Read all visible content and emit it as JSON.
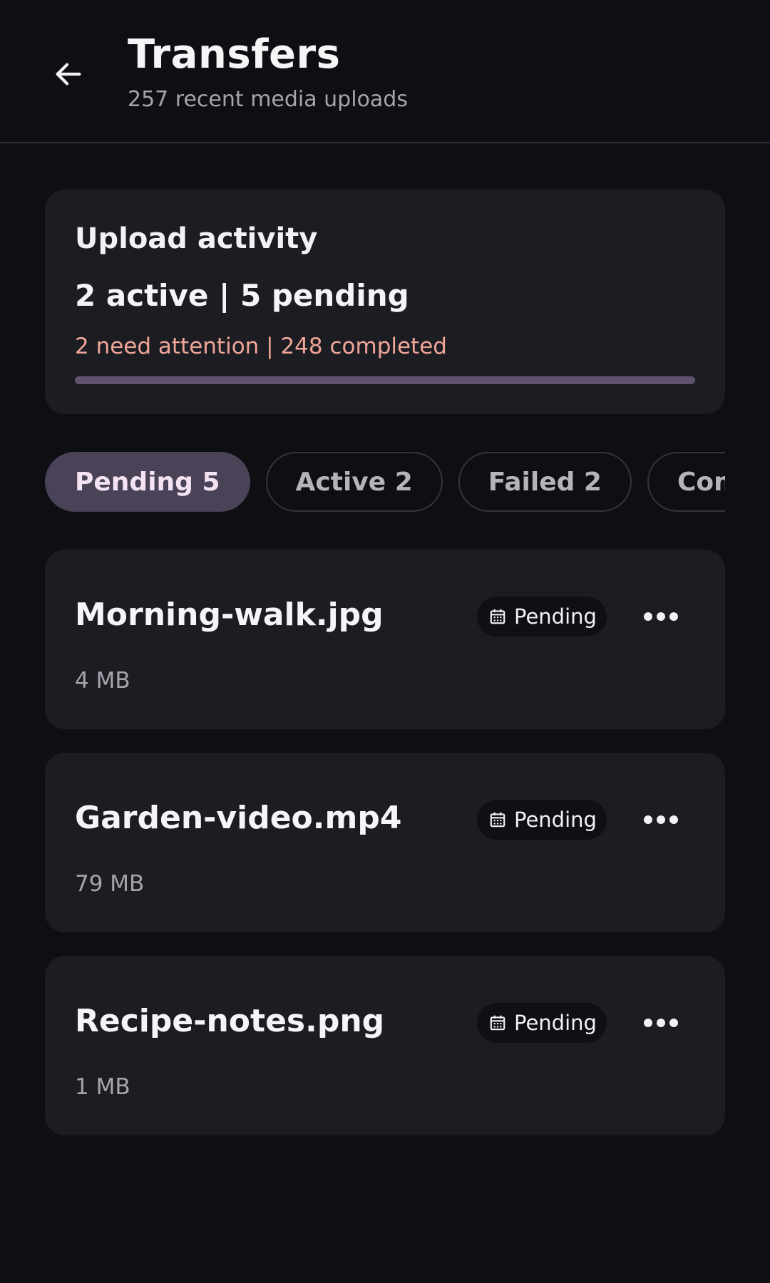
{
  "header": {
    "title": "Transfers",
    "subtitle": "257 recent media uploads",
    "back_icon": "arrow-left-icon"
  },
  "summary": {
    "heading": "Upload activity",
    "counts": "2 active | 5 pending",
    "alert": "2 need attention | 248 completed",
    "progress_fraction": 1.0
  },
  "filters": [
    {
      "label": "Pending 5",
      "selected": true
    },
    {
      "label": "Active 2",
      "selected": false
    },
    {
      "label": "Failed 2",
      "selected": false
    },
    {
      "label": "Complet",
      "selected": false
    }
  ],
  "files": [
    {
      "name": "Morning-walk.jpg",
      "size": "4 MB",
      "status": "Pending",
      "status_icon": "calendar-icon",
      "menu_icon": "more-horizontal-icon"
    },
    {
      "name": "Garden-video.mp4",
      "size": "79 MB",
      "status": "Pending",
      "status_icon": "calendar-icon",
      "menu_icon": "more-horizontal-icon"
    },
    {
      "name": "Recipe-notes.png",
      "size": "1 MB",
      "status": "Pending",
      "status_icon": "calendar-icon",
      "menu_icon": "more-horizontal-icon"
    }
  ],
  "colors": {
    "background": "#0e0f13",
    "card": "#1c1d22",
    "accent": "#4a4257",
    "alert": "#f0a598"
  }
}
